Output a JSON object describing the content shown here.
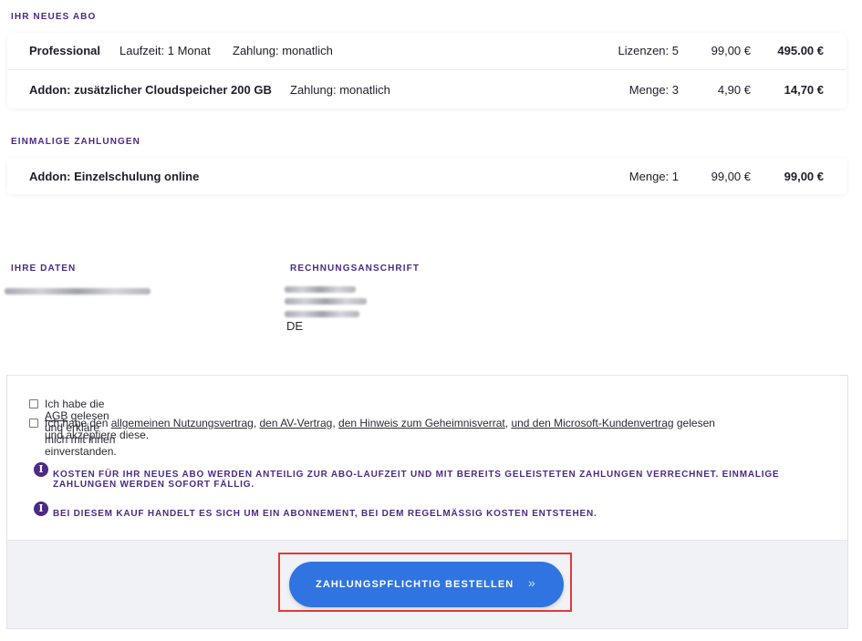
{
  "subscription": {
    "heading": "IHR NEUES ABO",
    "items": [
      {
        "name": "Professional",
        "duration": "Laufzeit: 1 Monat",
        "payment": "Zahlung: monatlich",
        "qty": "Lizenzen: 5",
        "unit_price": "99,00 €",
        "total": "495.00 €"
      },
      {
        "name": "Addon: zusätzlicher Cloudspeicher 200 GB",
        "payment": "Zahlung: monatlich",
        "qty": "Menge: 3",
        "unit_price": "4,90 €",
        "total": "14,70 €"
      }
    ]
  },
  "one_time": {
    "heading": "EINMALIGE ZAHLUNGEN",
    "items": [
      {
        "name": "Addon: Einzelschulung online",
        "qty": "Menge: 1",
        "unit_price": "99,00 €",
        "total": "99,00 €"
      }
    ]
  },
  "your_data": {
    "heading": "IHRE DATEN"
  },
  "billing_address": {
    "heading": "RECHNUNGSANSCHRIFT",
    "country": "DE"
  },
  "terms": {
    "agb": {
      "prefix": "Ich habe die ",
      "link": "AGB",
      "suffix": " gelesen und erkläre mich mit ihnen einverstanden."
    },
    "contracts": {
      "prefix": "Ich habe den ",
      "link1": "allgemeinen Nutzungsvertrag",
      "sep1": ", ",
      "link2": "den AV-Vertrag",
      "sep2": ", ",
      "link3": "den Hinweis zum Geheimnisverrat",
      "sep3": ", ",
      "link4": "und den Microsoft-Kundenvertrag",
      "suffix": " gelesen",
      "line2": "und akzeptiere diese."
    },
    "info1": "KOSTEN FÜR IHR NEUES ABO WERDEN ANTEILIG ZUR ABO-LAUFZEIT UND MIT BEREITS GELEISTETEN ZAHLUNGEN VERRECHNET. EINMALIGE ZAHLUNGEN WERDEN SOFORT FÄLLIG.",
    "info2": "BEI DIESEM KAUF HANDELT ES SICH UM EIN ABONNEMENT, BEI DEM REGELMÄSSIG KOSTEN ENTSTEHEN.",
    "info_icon": "i"
  },
  "order_button": {
    "label": "ZAHLUNGSPFLICHTIG BESTELLEN",
    "chevron": "»"
  },
  "colors": {
    "accent": "#4c2a86",
    "button": "#2f74e0",
    "highlight": "#e53935"
  }
}
